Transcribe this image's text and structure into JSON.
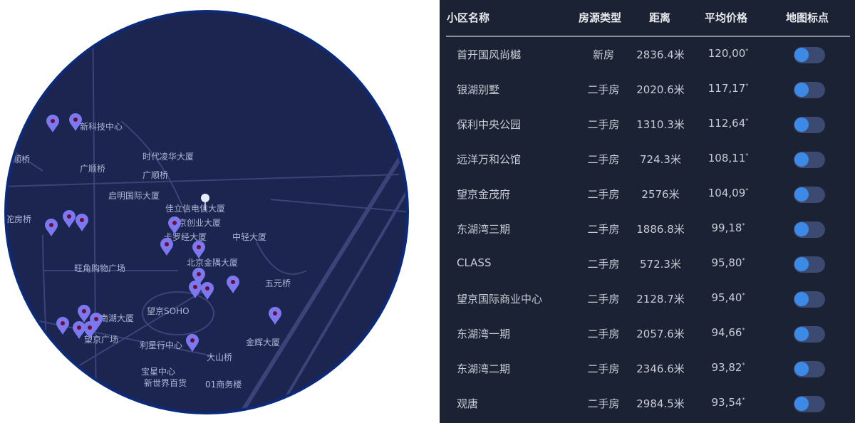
{
  "map": {
    "labels": [
      "新科技中心",
      "广顺桥",
      "时代凌华大厦",
      "广顺桥",
      "广顺桥",
      "启明国际大厦",
      "佳立信电信大厦",
      "望京创业大厦",
      "卡罗经大厦",
      "中轻大厦",
      "驼房桥",
      "旺角购物广场",
      "北京金隅大厦",
      "望京SOHO",
      "利星行中心",
      "大山桥",
      "宝星中心",
      "新世界百货",
      "01商务楼",
      "金辉大厦",
      "五元桥",
      "南湖大厦",
      "望京广场"
    ],
    "pin_color": "#7b78f0",
    "background_color": "#1c2450"
  },
  "table": {
    "headers": {
      "name": "小区名称",
      "type": "房源类型",
      "distance": "距离",
      "price": "平均价格",
      "map_marker": "地图标点"
    },
    "rows": [
      {
        "name": "首开国风尚樾",
        "type": "新房",
        "distance": "2836.4米",
        "price": "120,00",
        "price_suffix": "*",
        "marker_on": false
      },
      {
        "name": "银湖别墅",
        "type": "二手房",
        "distance": "2020.6米",
        "price": "117,17",
        "price_suffix": "*",
        "marker_on": false
      },
      {
        "name": "保利中央公园",
        "type": "二手房",
        "distance": "1310.3米",
        "price": "112,64",
        "price_suffix": "*",
        "marker_on": false
      },
      {
        "name": "远洋万和公馆",
        "type": "二手房",
        "distance": "724.3米",
        "price": "108,11",
        "price_suffix": "*",
        "marker_on": false
      },
      {
        "name": "望京金茂府",
        "type": "二手房",
        "distance": "2576米",
        "price": "104,09",
        "price_suffix": "*",
        "marker_on": false
      },
      {
        "name": "东湖湾三期",
        "type": "二手房",
        "distance": "1886.8米",
        "price": "99,18",
        "price_suffix": "*",
        "marker_on": false
      },
      {
        "name": "CLASS",
        "type": "二手房",
        "distance": "572.3米",
        "price": "95,80",
        "price_suffix": "*",
        "marker_on": false
      },
      {
        "name": "望京国际商业中心",
        "type": "二手房",
        "distance": "2128.7米",
        "price": "95,40",
        "price_suffix": "*",
        "marker_on": false
      },
      {
        "name": "东湖湾一期",
        "type": "二手房",
        "distance": "2057.6米",
        "price": "94,66",
        "price_suffix": "*",
        "marker_on": false
      },
      {
        "name": "东湖湾二期",
        "type": "二手房",
        "distance": "2346.6米",
        "price": "93,82",
        "price_suffix": "*",
        "marker_on": false
      },
      {
        "name": "观唐",
        "type": "二手房",
        "distance": "2984.5米",
        "price": "93,54",
        "price_suffix": "*",
        "marker_on": false
      }
    ],
    "toggle_track_color": "#3c4a72",
    "toggle_knob_color": "#3c8ae6"
  }
}
